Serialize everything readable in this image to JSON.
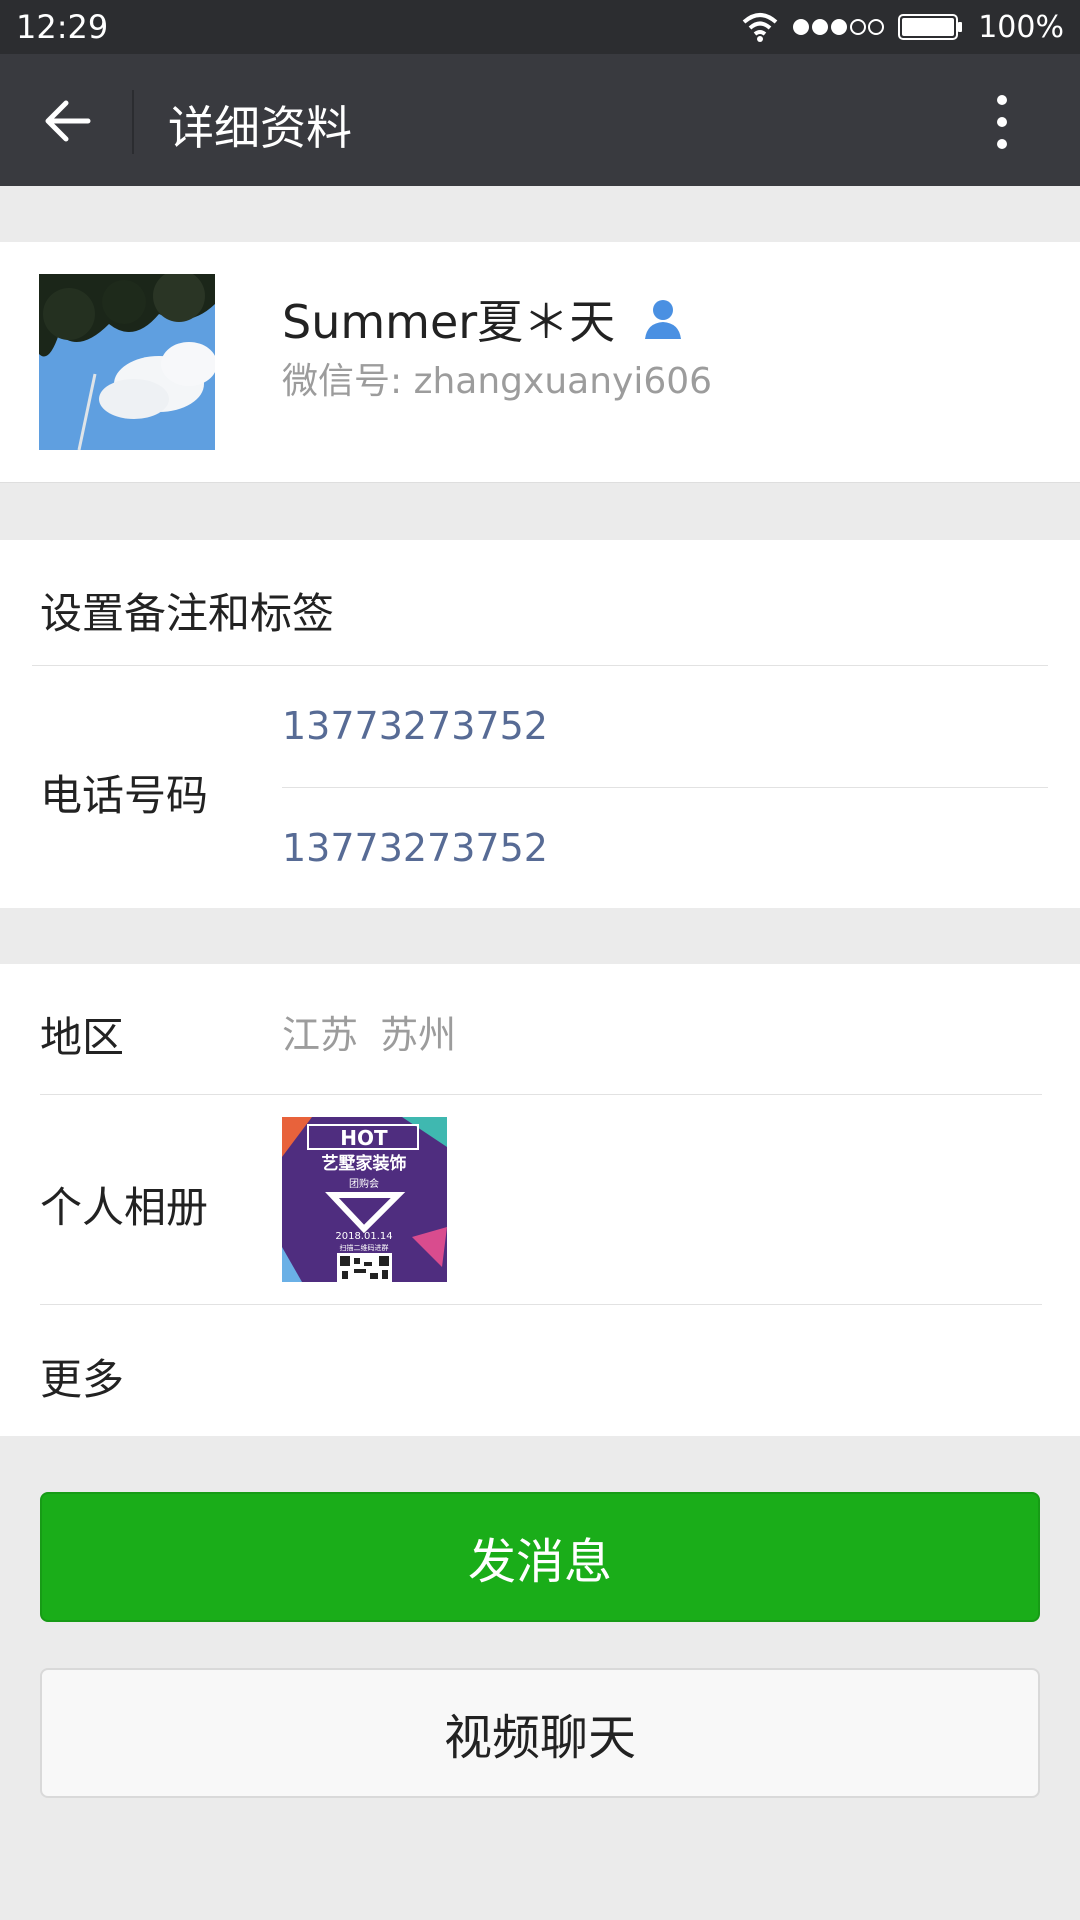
{
  "status_bar": {
    "time": "12:29",
    "battery": "100%"
  },
  "nav": {
    "title": "详细资料"
  },
  "profile": {
    "nickname": "Summer夏＊天",
    "wechat_id": "微信号: zhangxuanyi606"
  },
  "rows": {
    "remark": "设置备注和标签",
    "phone_label": "电话号码",
    "phones": [
      "13773273752",
      "13773273752"
    ],
    "region_label": "地区",
    "region_value": "江苏  苏州",
    "album_label": "个人相册",
    "album_thumb": {
      "badge": "HOT",
      "title": "艺墅家装饰",
      "subtitle": "团购会",
      "date": "2018.01.14",
      "caption": "扫描二维码进群"
    },
    "more_label": "更多"
  },
  "buttons": {
    "send": "发消息",
    "video": "视频聊天"
  },
  "colors": {
    "accent_green": "#1aad19",
    "link_blue": "#576b95",
    "navbar": "#393a3f"
  }
}
